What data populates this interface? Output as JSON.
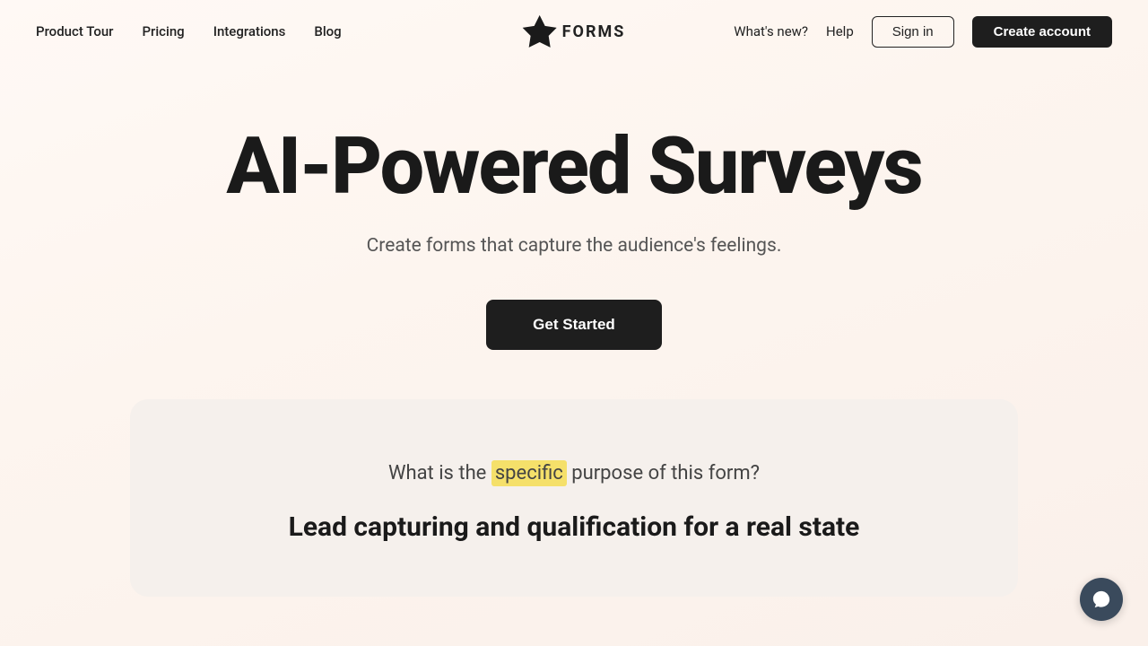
{
  "nav": {
    "links": [
      {
        "label": "Product Tour",
        "id": "product-tour"
      },
      {
        "label": "Pricing",
        "id": "pricing"
      },
      {
        "label": "Integrations",
        "id": "integrations"
      },
      {
        "label": "Blog",
        "id": "blog"
      }
    ],
    "logo_text": "FORMS",
    "right_links": [
      {
        "label": "What's new?",
        "id": "whats-new"
      },
      {
        "label": "Help",
        "id": "help"
      }
    ],
    "signin_label": "Sign in",
    "create_account_label": "Create account"
  },
  "hero": {
    "title": "AI-Powered Surveys",
    "subtitle": "Create forms that capture the audience's feelings.",
    "cta_label": "Get Started"
  },
  "demo": {
    "question_before": "What is the",
    "question_highlight": "specific",
    "question_after": "purpose of this form?",
    "answer": "Lead capturing and qualification for a real state"
  },
  "chat": {
    "label": "chat-support"
  }
}
